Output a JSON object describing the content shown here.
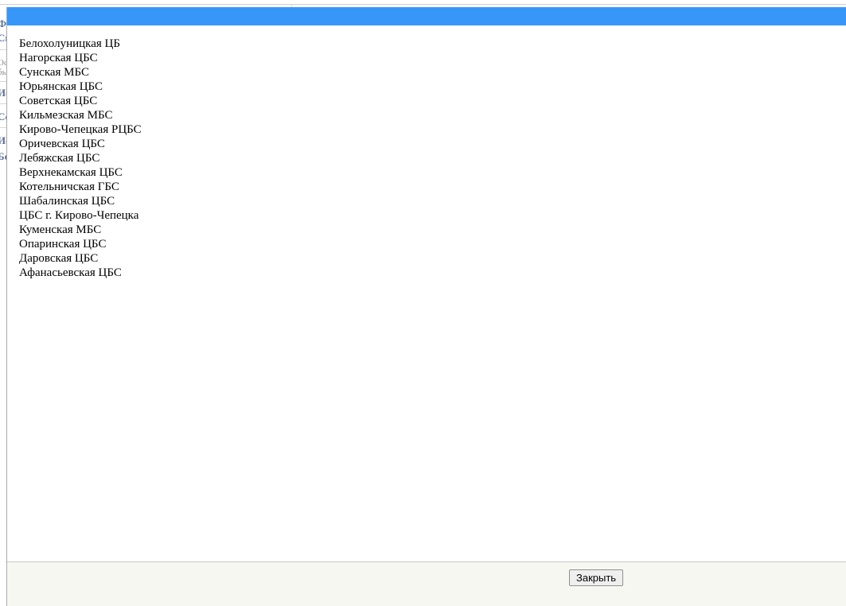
{
  "background_page": {
    "fragments": [
      "Ф",
      "Св",
      "Ос",
      "бы",
      "Ис",
      "Сс",
      "Ис",
      "Бе"
    ]
  },
  "dialog": {
    "titlebar_color": "#3797f8",
    "libraries": [
      "Белохолуницкая ЦБ",
      "Нагорская ЦБС",
      "Сунская МБС",
      "Юрьянская ЦБС",
      "Советская ЦБС",
      "Кильмезская МБС",
      "Кирово-Чепецкая РЦБС",
      "Оричевская ЦБС",
      "Лебяжская ЦБС",
      "Верхнекамская ЦБС",
      "Котельничская ГБС",
      "Шабалинская ЦБС",
      "ЦБС г. Кирово-Чепецка",
      "Куменская МБС",
      "Опаринская ЦБС",
      "Даровская ЦБС",
      "Афанасьевская ЦБС"
    ],
    "footer": {
      "close_label": "Закрыть"
    }
  }
}
